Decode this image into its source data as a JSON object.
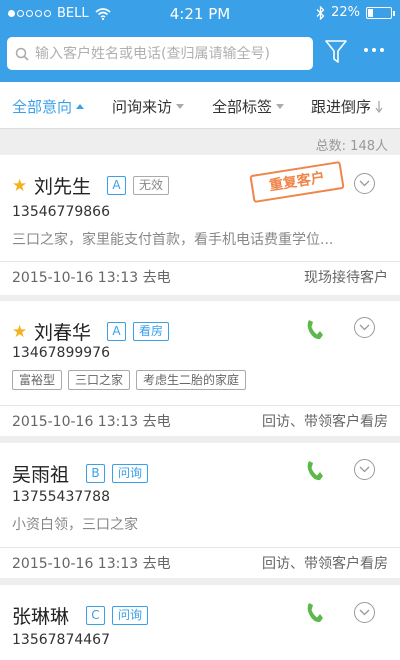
{
  "status_bar": {
    "carrier": "BELL",
    "time": "4:21 PM",
    "battery": "22%"
  },
  "header": {
    "search": {
      "placeholder": "输入客户姓名或电话(查归属请输全号)",
      "value": ""
    }
  },
  "tabs": [
    {
      "label": "全部意向",
      "active": true
    },
    {
      "label": "问询来访",
      "active": false
    },
    {
      "label": "全部标签",
      "active": false
    },
    {
      "label": "跟进倒序",
      "active": false
    }
  ],
  "total_label": "总数: 148人",
  "colors": {
    "brand": "#3aa0e8",
    "star": "#f3b21b",
    "stamp": "#f0854a",
    "phone": "#5bb84a"
  },
  "customers": [
    {
      "name": "刘先生",
      "starred": true,
      "grade": "A",
      "status": "无效",
      "phone": "13546779866",
      "desc": "三口之家，家里能支付首款，看手机电话费重学位...",
      "stamp": "重复客户",
      "date": "2015-10-16 13:13 去电",
      "action": "现场接待客户"
    },
    {
      "name": "刘春华",
      "starred": true,
      "grade": "A",
      "status": "看房",
      "phone": "13467899976",
      "tags": [
        "富裕型",
        "三口之家",
        "考虑生二胎的家庭"
      ],
      "date": "2015-10-16 13:13 去电",
      "action": "回访、带领客户看房"
    },
    {
      "name": "吴雨祖",
      "starred": false,
      "grade": "B",
      "status": "问询",
      "phone": "13755437788",
      "desc": "小资白领，三口之家",
      "date": "2015-10-16 13:13 去电",
      "action": "回访、带领客户看房"
    },
    {
      "name": "张琳琳",
      "starred": false,
      "grade": "C",
      "status": "问询",
      "phone": "13567874467"
    }
  ]
}
